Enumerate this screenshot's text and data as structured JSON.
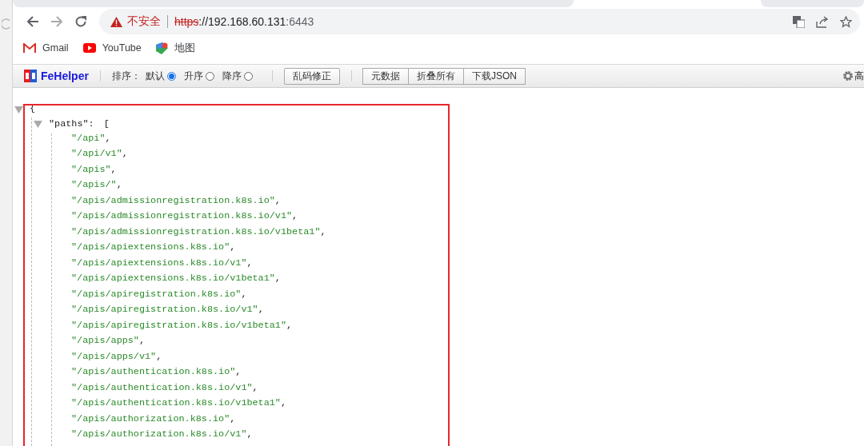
{
  "address_bar": {
    "security": "不安全",
    "scheme": "https",
    "host": "://192.168.60.131",
    "port": ":6443"
  },
  "bookmarks": [
    {
      "kind": "gmail",
      "label": "Gmail"
    },
    {
      "kind": "youtube",
      "label": "YouTube"
    },
    {
      "kind": "maps",
      "label": "地图"
    }
  ],
  "fehelper": {
    "brand": "FeHelper",
    "sort_label": "排序：",
    "sort_options": [
      {
        "label": "默认",
        "selected": true
      },
      {
        "label": "升序",
        "selected": false
      },
      {
        "label": "降序",
        "selected": false
      }
    ],
    "fix_button": "乱码修正",
    "buttons": [
      "元数据",
      "折叠所有",
      "下载JSON"
    ],
    "settings": "高"
  },
  "json_view": {
    "open_brace": "{",
    "key": "\"paths\"",
    "colon": ":",
    "open_bracket": "[",
    "expanded": true,
    "items": [
      {
        "value": "\"/api\"",
        "sep": ","
      },
      {
        "value": "\"/api/v1\"",
        "sep": ","
      },
      {
        "value": "\"/apis\"",
        "sep": ","
      },
      {
        "value": "\"/apis/\"",
        "sep": ","
      },
      {
        "value": "\"/apis/admissionregistration.k8s.io\"",
        "sep": ","
      },
      {
        "value": "\"/apis/admissionregistration.k8s.io/v1\"",
        "sep": ","
      },
      {
        "value": "\"/apis/admissionregistration.k8s.io/v1beta1\"",
        "sep": ","
      },
      {
        "value": "\"/apis/apiextensions.k8s.io\"",
        "sep": ","
      },
      {
        "value": "\"/apis/apiextensions.k8s.io/v1\"",
        "sep": ","
      },
      {
        "value": "\"/apis/apiextensions.k8s.io/v1beta1\"",
        "sep": ","
      },
      {
        "value": "\"/apis/apiregistration.k8s.io\"",
        "sep": ","
      },
      {
        "value": "\"/apis/apiregistration.k8s.io/v1\"",
        "sep": ","
      },
      {
        "value": "\"/apis/apiregistration.k8s.io/v1beta1\"",
        "sep": ","
      },
      {
        "value": "\"/apis/apps\"",
        "sep": ","
      },
      {
        "value": "\"/apis/apps/v1\"",
        "sep": ","
      },
      {
        "value": "\"/apis/authentication.k8s.io\"",
        "sep": ","
      },
      {
        "value": "\"/apis/authentication.k8s.io/v1\"",
        "sep": ","
      },
      {
        "value": "\"/apis/authentication.k8s.io/v1beta1\"",
        "sep": ","
      },
      {
        "value": "\"/apis/authorization.k8s.io\"",
        "sep": ","
      },
      {
        "value": "\"/apis/authorization.k8s.io/v1\"",
        "sep": ","
      }
    ]
  }
}
